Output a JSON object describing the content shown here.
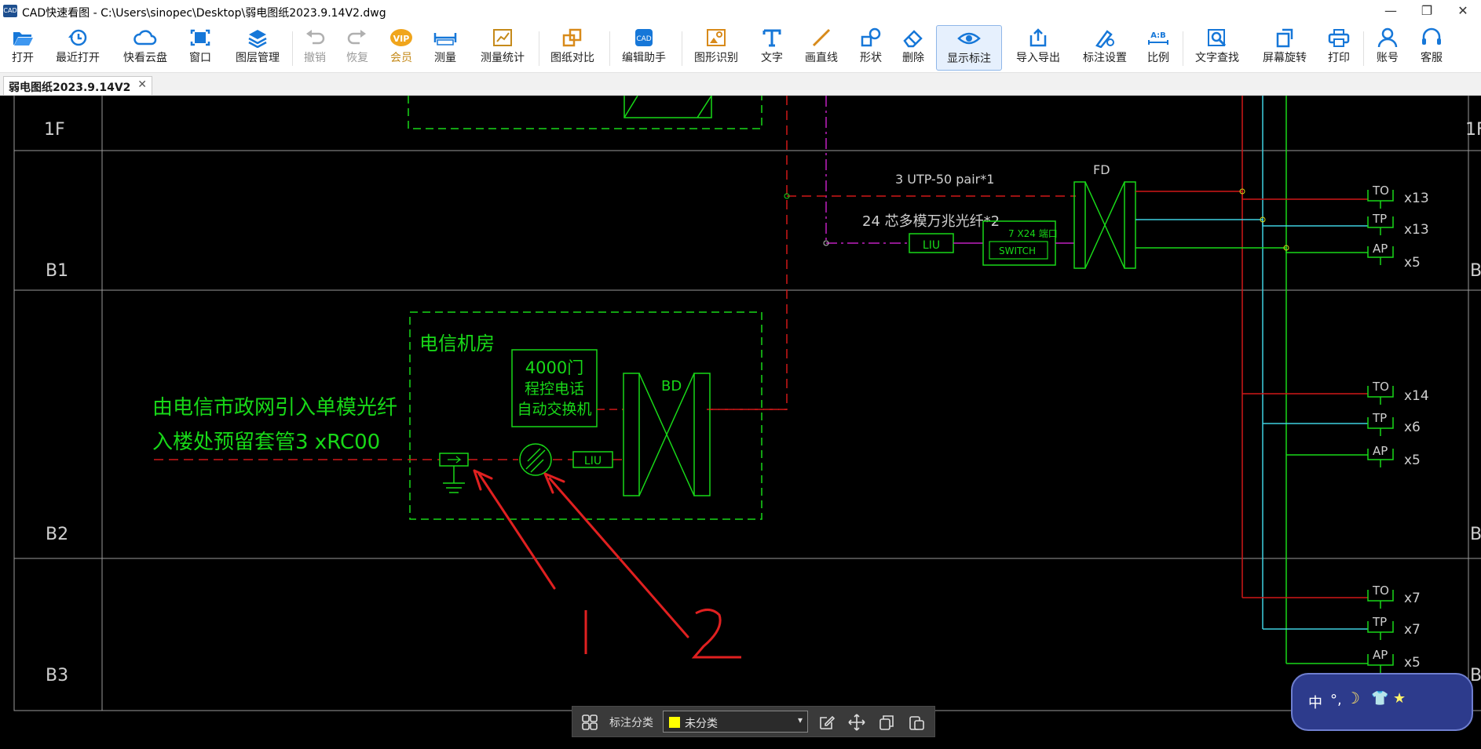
{
  "window": {
    "app_icon_text": "CAD",
    "title": "CAD快速看图 - C:\\Users\\sinopec\\Desktop\\弱电图纸2023.9.14V2.dwg",
    "minimize": "—",
    "restore": "❐",
    "close": "✕"
  },
  "toolbar": {
    "items": [
      {
        "label": "打开",
        "icon": "folder-open-icon"
      },
      {
        "label": "最近打开",
        "icon": "history-icon"
      },
      {
        "label": "快看云盘",
        "icon": "cloud-icon"
      },
      {
        "label": "窗口",
        "icon": "window-icon"
      },
      {
        "label": "图层管理",
        "icon": "layers-icon"
      },
      {
        "label": "撤销",
        "icon": "undo-icon",
        "disabled": true
      },
      {
        "label": "恢复",
        "icon": "redo-icon",
        "disabled": true
      },
      {
        "label": "会员",
        "icon": "vip-badge-icon",
        "badge": "VIP"
      },
      {
        "label": "测量",
        "icon": "ruler-icon"
      },
      {
        "label": "测量统计",
        "icon": "measure-stats-icon"
      },
      {
        "label": "图纸对比",
        "icon": "compare-icon"
      },
      {
        "label": "编辑助手",
        "icon": "cad-edit-icon"
      },
      {
        "label": "图形识别",
        "icon": "shape-recognize-icon"
      },
      {
        "label": "文字",
        "icon": "text-icon"
      },
      {
        "label": "画直线",
        "icon": "line-icon"
      },
      {
        "label": "形状",
        "icon": "shapes-icon"
      },
      {
        "label": "删除",
        "icon": "eraser-icon"
      },
      {
        "label": "显示标注",
        "icon": "eye-icon",
        "active": true
      },
      {
        "label": "导入导出",
        "icon": "import-export-icon"
      },
      {
        "label": "标注设置",
        "icon": "annotation-settings-icon"
      },
      {
        "label": "比例",
        "icon": "scale-icon",
        "badge": "A:B"
      },
      {
        "label": "文字查找",
        "icon": "text-search-icon"
      },
      {
        "label": "屏幕旋转",
        "icon": "rotate-screen-icon"
      },
      {
        "label": "打印",
        "icon": "printer-icon"
      },
      {
        "label": "账号",
        "icon": "user-icon"
      },
      {
        "label": "客服",
        "icon": "headset-icon"
      }
    ]
  },
  "tabs": [
    {
      "label": "弱电图纸2023.9.14V2",
      "close": "✕"
    }
  ],
  "drawing": {
    "floors": [
      "1F",
      "B1",
      "B2",
      "B3",
      "1F",
      "B",
      "B",
      "B"
    ],
    "fd_label": "FD",
    "bd_label": "BD",
    "cable_utp": "3 UTP-50 pair*1",
    "fiber_label": "24 芯多模万兆光纤*2",
    "liu": "LIU",
    "switch_ports": "7 X24 端口",
    "switch": "SWITCH",
    "room_label": "电信机房",
    "pbx": [
      "4000门",
      "程控电话",
      "自动交换机"
    ],
    "incoming_line1": "由电信市政网引入单模光纤",
    "incoming_line2": "入楼处预留套管3 xRC00",
    "outlets": [
      {
        "type": "TO",
        "count": "x13"
      },
      {
        "type": "TP",
        "count": "x13"
      },
      {
        "type": "AP",
        "count": "x5"
      },
      {
        "type": "TO",
        "count": "x14"
      },
      {
        "type": "TP",
        "count": "x6"
      },
      {
        "type": "AP",
        "count": "x5"
      },
      {
        "type": "TO",
        "count": "x7"
      },
      {
        "type": "TP",
        "count": "x7"
      },
      {
        "type": "AP",
        "count": "x5"
      }
    ],
    "markers": [
      "1",
      "2"
    ]
  },
  "bottombar": {
    "label": "标注分类",
    "selected": "未分类",
    "swatch_color": "#ffff00",
    "arrow": "▾"
  },
  "ime": {
    "mode": "中",
    "punct": "°,",
    "moon": "☽",
    "shirt": "👕",
    "star": "★"
  },
  "colors": {
    "cad_background": "#000000",
    "cad_green": "#18d818",
    "cad_red": "#d01818",
    "cad_cyan": "#3fd0e0",
    "cad_magenta": "#c020c0",
    "annotation_red": "#e02020",
    "toolbar_icon_blue": "#1677d8"
  }
}
